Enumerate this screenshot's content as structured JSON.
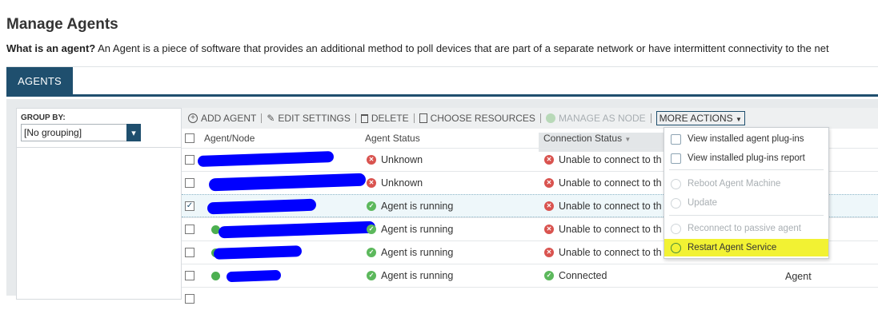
{
  "page": {
    "title": "Manage Agents",
    "intro_question": "What is an agent?",
    "intro_text": " An Agent is a piece of software that provides an additional method to poll devices that are part of a separate network or have intermittent connectivity to the net"
  },
  "tabs": [
    {
      "label": "AGENTS",
      "active": true
    }
  ],
  "group_by": {
    "label": "GROUP BY:",
    "value": "[No grouping]"
  },
  "toolbar": {
    "add_agent": "ADD AGENT",
    "edit_settings": "EDIT SETTINGS",
    "delete": "DELETE",
    "choose_resources": "CHOOSE RESOURCES",
    "manage_as_node": "MANAGE AS NODE",
    "more_actions": "MORE ACTIONS"
  },
  "table": {
    "columns": [
      "Agent/Node",
      "Agent Status",
      "Connection Status"
    ],
    "rows": [
      {
        "agent_status": "Unknown",
        "agent_status_color": "#d9534f",
        "connection_status": "Unable to connect to th",
        "connection_color": "#d9534f",
        "checked": false
      },
      {
        "agent_status": "Unknown",
        "agent_status_color": "#d9534f",
        "connection_status": "Unable to connect to th",
        "connection_color": "#d9534f",
        "checked": false
      },
      {
        "agent_status": "Agent is running",
        "agent_status_color": "#5cb85c",
        "connection_status": "Unable to connect to th",
        "connection_color": "#d9534f",
        "checked": true
      },
      {
        "agent_status": "Agent is running",
        "agent_status_color": "#5cb85c",
        "connection_status": "Unable to connect to th",
        "connection_color": "#d9534f",
        "checked": false
      },
      {
        "agent_status": "Agent is running",
        "agent_status_color": "#5cb85c",
        "connection_status": "Unable to connect to th",
        "connection_color": "#d9534f",
        "checked": false
      },
      {
        "agent_status": "Agent is running",
        "agent_status_color": "#5cb85c",
        "connection_status": "Connected",
        "connection_color": "#5cb85c",
        "checked": false,
        "extra": "Agent"
      }
    ]
  },
  "more_actions_menu": {
    "items": [
      {
        "label": "View installed agent plug-ins",
        "enabled": true
      },
      {
        "label": "View installed plug-ins report",
        "enabled": true
      },
      {
        "label": "Reboot Agent Machine",
        "enabled": false
      },
      {
        "label": "Update",
        "enabled": false
      },
      {
        "label": "Reconnect to passive agent",
        "enabled": false
      },
      {
        "label": "Restart Agent Service",
        "enabled": true,
        "highlighted": true
      }
    ]
  },
  "colors": {
    "brand": "#1f4f6e",
    "highlight": "#f2f233",
    "redaction": "#0000ff"
  }
}
